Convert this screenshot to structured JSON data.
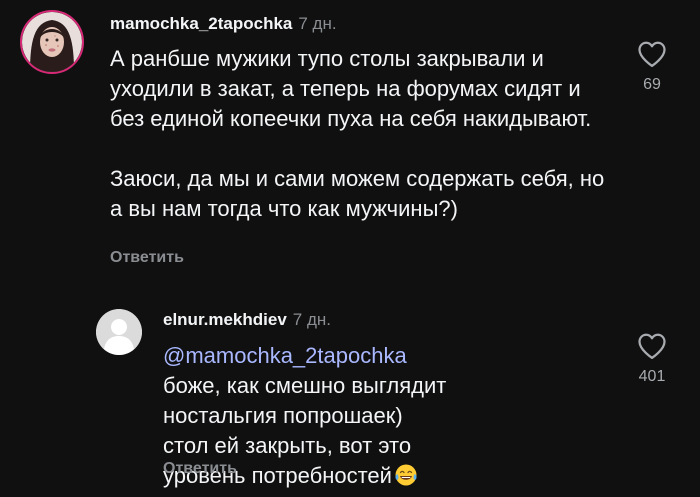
{
  "comments": [
    {
      "username": "mamochka_2tapochka",
      "time": "7 дн.",
      "paragraphs": [
        "А ранбше мужики тупо столы закрывали и уходили в закат, а теперь на форумах сидят и без единой копеечки пуха на себя накидывают.",
        "Заюси, да мы и сами можем содержать себя, но а вы нам тогда что как мужчины?)"
      ],
      "reply_label": "Ответить",
      "likes": "69"
    }
  ],
  "reply": {
    "username": "elnur.mekhdiev",
    "time": "7 дн.",
    "mention": "@mamochka_2tapochka",
    "text": " боже, как смешно выглядит ностальгия попрошаек) стол ей закрыть, вот это уровень потребностей",
    "emoji": "tears-of-joy-emoji",
    "reply_label": "Ответить",
    "likes": "401"
  },
  "colors": {
    "background": "#101010",
    "text": "#f3f5f7",
    "muted": "#8a8d91",
    "mention": "#a9b8ff",
    "story_ring": "#d62976"
  },
  "icons": [
    "heart-icon",
    "default-avatar-icon"
  ]
}
